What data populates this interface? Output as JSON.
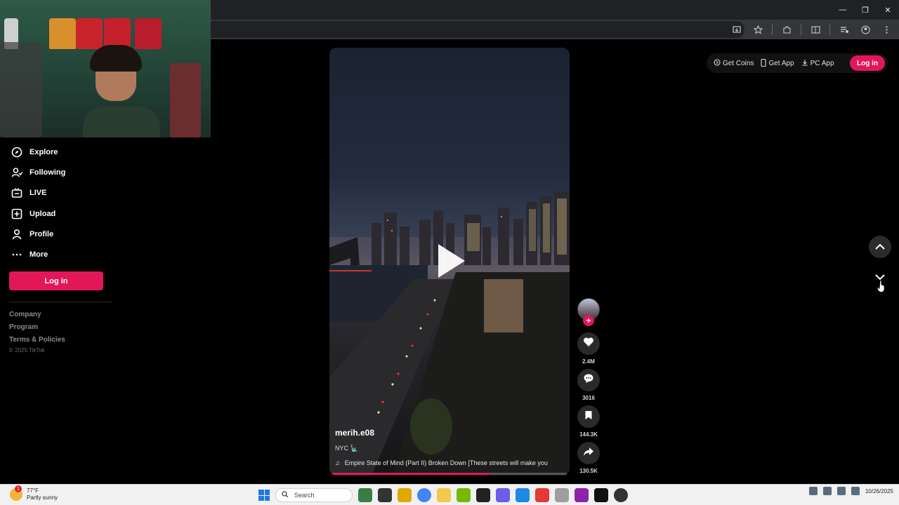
{
  "browser": {
    "window_controls": [
      "—",
      "❐",
      "✕"
    ]
  },
  "sidebar": {
    "items": [
      {
        "label": "Explore",
        "icon": "compass-icon"
      },
      {
        "label": "Following",
        "icon": "following-icon"
      },
      {
        "label": "LIVE",
        "icon": "live-icon"
      },
      {
        "label": "Upload",
        "icon": "upload-icon"
      },
      {
        "label": "Profile",
        "icon": "profile-icon"
      },
      {
        "label": "More",
        "icon": "more-icon"
      }
    ],
    "login_label": "Log in",
    "footer_links": [
      "Company",
      "Program",
      "Terms & Policies"
    ],
    "copyright": "© 2025 TikTok"
  },
  "topbar": {
    "get_coins": "Get Coins",
    "get_app": "Get App",
    "pc_app": "PC App",
    "login": "Log in"
  },
  "video": {
    "username": "merih.e08",
    "caption": "NYC 🗽",
    "music": "Empire State of Mind (Part II) Broken Down [These streets will make you",
    "progress": 0.67
  },
  "actions": {
    "likes": "2.4M",
    "comments": "3016",
    "saves": "144.3K",
    "shares": "130.5K"
  },
  "taskbar": {
    "temperature": "77°F",
    "weather": "Partly sunny",
    "weather_badge": "1",
    "search_placeholder": "Search",
    "date": "10/26/2025"
  },
  "colors": {
    "accent": "#e2175a",
    "background": "#000000"
  }
}
